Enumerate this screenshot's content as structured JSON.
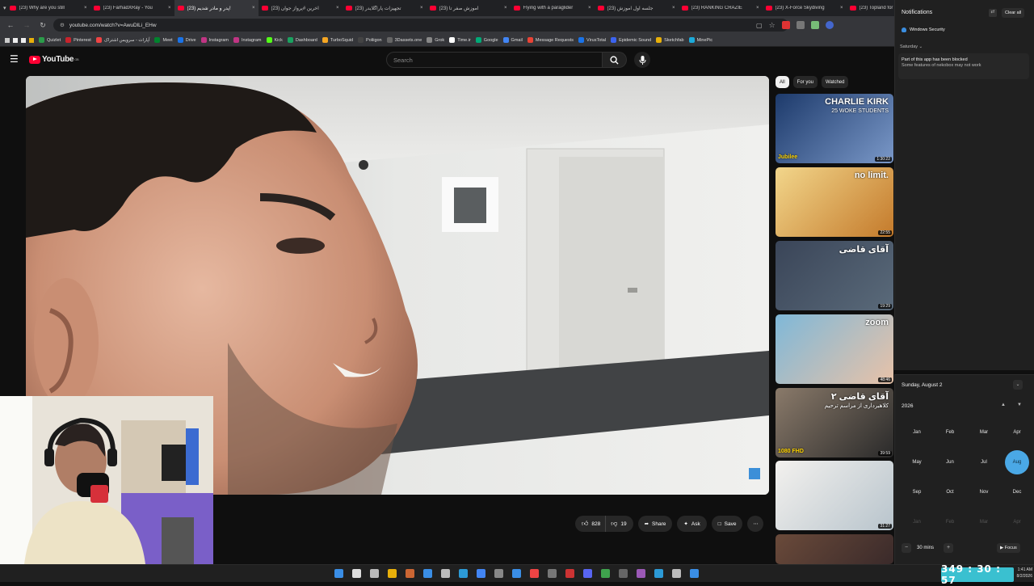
{
  "browser": {
    "tabs": [
      {
        "title": "(23) Why are you still"
      },
      {
        "title": "(23) FarhadXRay - You"
      },
      {
        "title": "(23) پدر و مادر شدیم!",
        "active": true
      },
      {
        "title": "(23) آخرین #پرواز جوان"
      },
      {
        "title": "(23) تجهیزات پاراگلایدر"
      },
      {
        "title": "(23) آموزش صفر تا"
      },
      {
        "title": "Flying with a paraglider"
      },
      {
        "title": "(23) جلسه اول آموزش"
      },
      {
        "title": "(23) RANKING CRAZIE"
      },
      {
        "title": "(23) X-Force Skydiving"
      },
      {
        "title": "(23) Topland for tandem"
      }
    ],
    "url": "youtube.com/watch?v=AwuDlLi_EHw",
    "bookmarks": [
      "Quizlet",
      "Pinterest",
      "آپارات - سرویس اشتراک",
      "Meet",
      "Drive",
      "Instagram",
      "Instagram",
      "Kick",
      "Dashboard",
      "TurboSquid",
      "Poliigon",
      "3Dassets.one",
      "Grok",
      "Time.ir",
      "Google",
      "Gmail",
      "Message Requests",
      "VirusTotal",
      "Epidemic Sound",
      "Sketchfab",
      "MinePic"
    ]
  },
  "youtube": {
    "logo_text": "YouTube",
    "region": "GB",
    "search_placeholder": "Search",
    "actions": {
      "likes": "828",
      "dislikes": "19",
      "share": "Share",
      "ask": "Ask",
      "save": "Save"
    },
    "chips": [
      "All",
      "For you",
      "Watched"
    ],
    "recommendations": [
      {
        "thumb_text": "CHARLIE KIRK",
        "thumb_sub": "25 WOKE STUDENTS",
        "badge": "Jubilee",
        "duration": "1:30:22"
      },
      {
        "thumb_text": "no limit.",
        "duration": "22:55"
      },
      {
        "thumb_text": "آقای قاضی",
        "duration": "19:29"
      },
      {
        "thumb_text": "zoom",
        "duration": "48:46"
      },
      {
        "thumb_text": "آقای قاضی ۲",
        "thumb_sub": "کلاهبرداری از مراسم ترحیم",
        "badge": "1080 FHD",
        "duration": "39:59"
      },
      {
        "thumb_text": "",
        "duration": "31:27"
      },
      {
        "thumb_text": "",
        "duration": ""
      }
    ]
  },
  "notifications": {
    "title": "Notifications",
    "clear_all": "Clear all",
    "source": "Windows Security",
    "day": "Saturday",
    "message_title": "Part of this app has been blocked",
    "message_body": "Some features of nekobox may not work"
  },
  "calendar": {
    "date_heading": "Sunday, August 2",
    "year": "2026",
    "months": [
      "Jan",
      "Feb",
      "Mar",
      "Apr",
      "May",
      "Jun",
      "Jul",
      "Aug",
      "Sep",
      "Oct",
      "Nov",
      "Dec"
    ],
    "next_months": [
      "Jan",
      "Feb",
      "Mar",
      "Apr"
    ],
    "selected": "Aug",
    "focus_duration": "30 mins",
    "focus_label": "Focus",
    "accent": "#4aa8e6"
  },
  "timer": {
    "display": "349 : 30 : 57"
  },
  "clock": {
    "time": "1:41 AM",
    "date": "8/2/2026"
  }
}
